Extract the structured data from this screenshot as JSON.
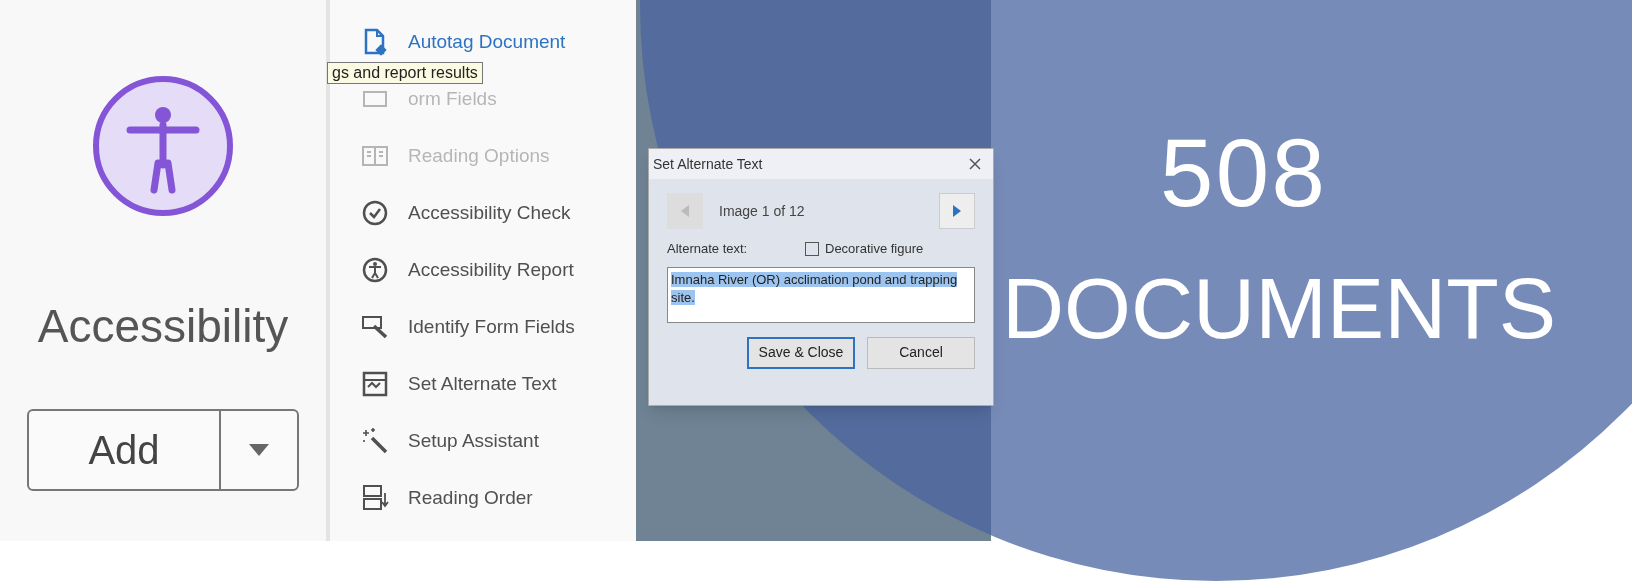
{
  "panel": {
    "title": "Accessibility",
    "add_button": "Add"
  },
  "tools": [
    {
      "label": "Autotag Document",
      "highlighted": true,
      "disabled": false
    },
    {
      "label": "orm Fields",
      "highlighted": false,
      "disabled": true
    },
    {
      "label": "Reading Options",
      "highlighted": false,
      "disabled": true
    },
    {
      "label": "Accessibility Check",
      "highlighted": false,
      "disabled": false
    },
    {
      "label": "Accessibility Report",
      "highlighted": false,
      "disabled": false
    },
    {
      "label": "Identify Form Fields",
      "highlighted": false,
      "disabled": false
    },
    {
      "label": "Set Alternate Text",
      "highlighted": false,
      "disabled": false
    },
    {
      "label": "Setup Assistant",
      "highlighted": false,
      "disabled": false
    },
    {
      "label": "Reading Order",
      "highlighted": false,
      "disabled": false
    }
  ],
  "tooltip": "gs and report results",
  "dialog": {
    "title": "Set Alternate Text",
    "counter": "Image 1 of 12",
    "field_label": "Alternate text:",
    "checkbox": {
      "label": "Decorative figure",
      "checked": false
    },
    "alt_text": "Imnaha River (OR) acclimation pond and trapping site.",
    "buttons": [
      {
        "label": "Save & Close",
        "selected": true
      },
      {
        "label": "Cancel",
        "selected": false
      }
    ]
  },
  "banner": {
    "line_1": "508",
    "line_2": "DOCUMENTS"
  }
}
